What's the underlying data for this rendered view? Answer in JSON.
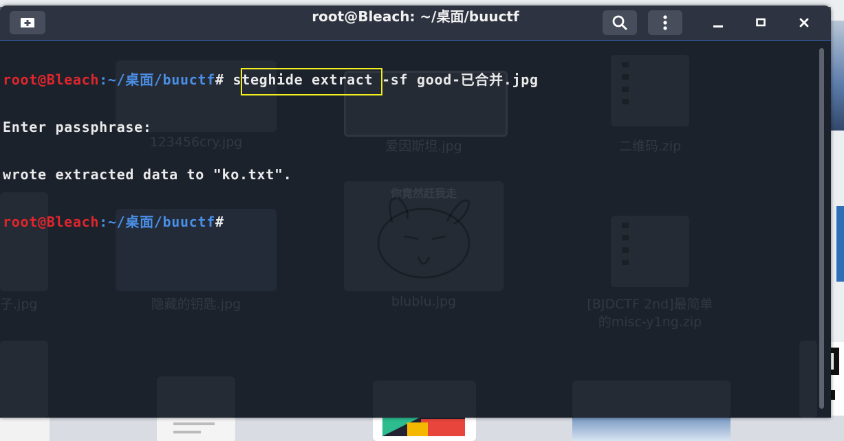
{
  "terminal": {
    "title": "root@Bleach: ~/桌面/buuctf",
    "lines": {
      "l1": {
        "user": "root@Bleach",
        "path": ":~/桌面/buuctf",
        "hash": "#",
        "command": " steghide extract -sf good-已合并.jpg"
      },
      "l2": {
        "text": "Enter passphrase:"
      },
      "l3": {
        "text_before": "wrote extracted data to ",
        "text_quoted": "\"ko.txt\"."
      },
      "l4": {
        "user": "root@Bleach",
        "path": ":~/桌面/buuctf",
        "hash": "#"
      }
    },
    "highlight_color": "#f2ef1e",
    "buttons": {
      "new_tab": "new-tab-icon",
      "search": "search-icon",
      "menu": "kebab-menu-icon",
      "minimize": "minimize-icon",
      "maximize": "maximize-icon",
      "close": "close-icon"
    }
  },
  "background_files": [
    {
      "label": "123456cry.jpg"
    },
    {
      "label": "爱因斯坦.jpg"
    },
    {
      "label": "二维码.zip"
    },
    {
      "label": "子.jpg"
    },
    {
      "label": "隐藏的钥匙.jpg"
    },
    {
      "label": "blublu.jpg",
      "caption": "你竟然赶我走"
    },
    {
      "label": "[BJDCTF 2nd]最简单",
      "label2": "的misc-y1ng.zip"
    }
  ],
  "colors": {
    "prompt_user": "#e0262c",
    "prompt_path": "#4a8fe6",
    "terminal_bg": "#1c222c",
    "titlebar_bg": "#2d3340"
  }
}
